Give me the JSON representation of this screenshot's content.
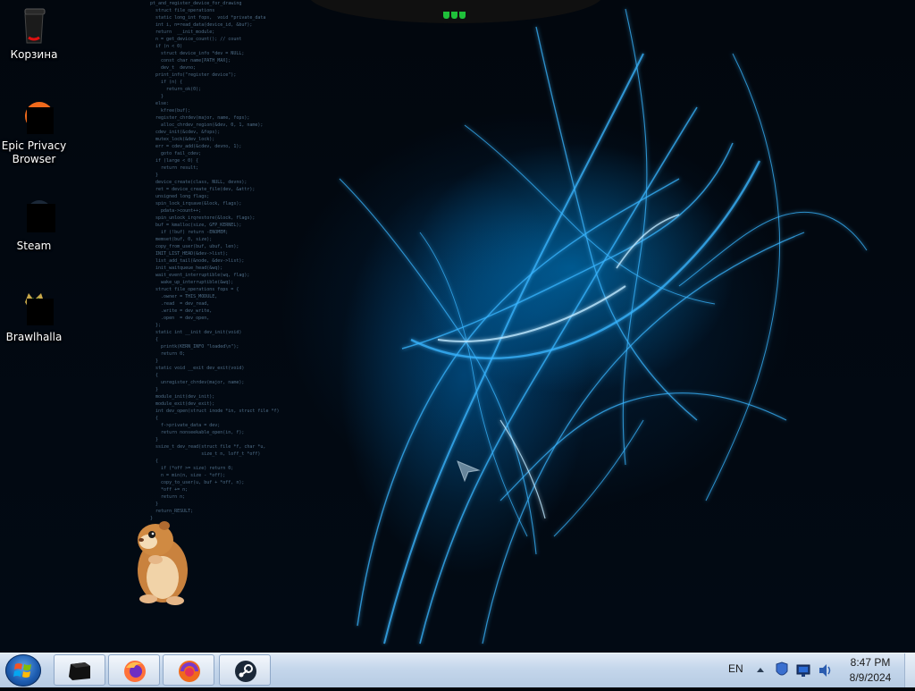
{
  "desktop": {
    "icons": [
      {
        "label": "Корзина",
        "icon": "recycle-bin-icon"
      },
      {
        "label": "Epic Privacy Browser",
        "icon": "epic-browser-icon"
      },
      {
        "label": "Steam",
        "icon": "steam-icon"
      },
      {
        "label": "Brawlhalla",
        "icon": "brawlhalla-icon"
      }
    ],
    "wallpaper": {
      "accent": "#1e9fe8",
      "background": "#01060c"
    },
    "code_lines": [
      "pt_and_register_device_for_drawing",
      "  struct file_operations",
      "  static long_int fops,  void *private_data",
      "  int i, n=read_data(device_id, &buf);",
      "  return  __init_module;",
      "",
      "  n = get_device_count(); // count",
      "  if (n < 0)",
      "    struct device_info *dev = NULL;",
      "    const char name[PATH_MAX];",
      "    dev_t  devno;",
      "",
      "  print_info(\"register device\");",
      "    if (n) {",
      "      return_ok(0);",
      "    }",
      "  else:",
      "    kfree(buf);",
      "  register_chrdev(major, name, fops);",
      "    alloc_chrdev_region(&dev, 0, 1, name);",
      "  cdev_init(&cdev, &fops);",
      "  mutex_lock(&dev_lock);",
      "  err = cdev_add(&cdev, devno, 1);",
      "    goto fail_cdev;",
      "",
      "  if (large < 0) {",
      "    return result;",
      "  }",
      "  device_create(class, NULL, devno);",
      "  ret = device_create_file(dev, &attr);",
      "",
      "  unsigned long flags;",
      "  spin_lock_irqsave(&lock, flags);",
      "    pdata->count++;",
      "  spin_unlock_irqrestore(&lock, flags);",
      "",
      "  buf = kmalloc(size, GFP_KERNEL);",
      "    if (!buf) return -ENOMEM;",
      "  memset(buf, 0, size);",
      "  copy_from_user(buf, ubuf, len);",
      "",
      "  INIT_LIST_HEAD(&dev->list);",
      "  list_add_tail(&node, &dev->list);",
      "",
      "  init_waitqueue_head(&wq);",
      "  wait_event_interruptible(wq, flag);",
      "    wake_up_interruptible(&wq);",
      "",
      "  struct file_operations fops = {",
      "    .owner = THIS_MODULE,",
      "    .read  = dev_read,",
      "    .write = dev_write,",
      "    .open  = dev_open,",
      "  };",
      "",
      "  static int __init dev_init(void)",
      "  {",
      "    printk(KERN_INFO \"loaded\\n\");",
      "    return 0;",
      "  }",
      "  static void __exit dev_exit(void)",
      "  {",
      "    unregister_chrdev(major, name);",
      "  }",
      "  module_init(dev_init);",
      "  module_exit(dev_exit);",
      "",
      "  int dev_open(struct inode *in, struct file *f)",
      "  {",
      "    f->private_data = dev;",
      "    return nonseekable_open(in, f);",
      "  }",
      "  ssize_t dev_read(struct file *f, char *u,",
      "                   size_t n, loff_t *off)",
      "  {",
      "    if (*off >= size) return 0;",
      "    n = min(n, size - *off);",
      "    copy_to_user(u, buf + *off, n);",
      "    *off += n;",
      "    return n;",
      "  }",
      "  return_RESULT;",
      "}"
    ]
  },
  "taskbar": {
    "start_icon": "windows-orb-icon",
    "pinned": [
      {
        "name": "terminal",
        "icon": "black-window-icon"
      },
      {
        "name": "firefox",
        "icon": "firefox-icon"
      },
      {
        "name": "epic",
        "icon": "epic-browser-icon"
      },
      {
        "name": "steam",
        "icon": "steam-icon"
      }
    ],
    "language": "EN",
    "tray_icons": [
      "show-hidden-icons-chevron",
      "shield-icon",
      "network-icon",
      "speaker-icon"
    ],
    "time": "8:47 PM",
    "date": "8/9/2024"
  }
}
